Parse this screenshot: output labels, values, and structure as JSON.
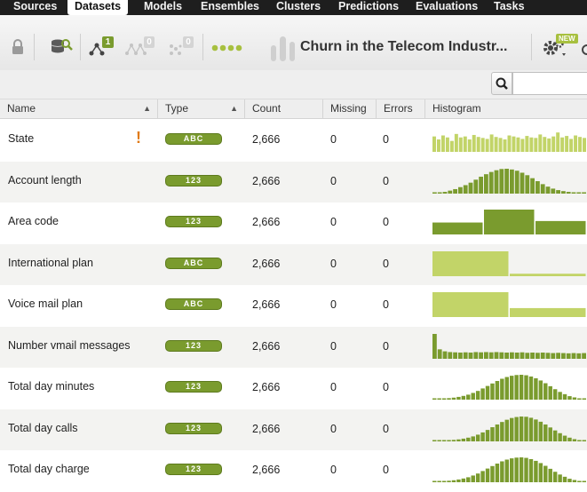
{
  "nav": {
    "tabs": [
      {
        "label": "Sources",
        "active": false
      },
      {
        "label": "Datasets",
        "active": true
      },
      {
        "label": "Models",
        "active": false
      },
      {
        "label": "Ensembles",
        "active": false
      },
      {
        "label": "Clusters",
        "active": false
      },
      {
        "label": "Predictions",
        "active": false
      },
      {
        "label": "Evaluations",
        "active": false
      },
      {
        "label": "Tasks",
        "active": false
      }
    ]
  },
  "toolbar": {
    "dataset_title": "Churn in the Telecom Industr...",
    "model_count_badge": "1",
    "ensemble_count_badge": "0",
    "cluster_count_badge": "0",
    "new_badge": "NEW"
  },
  "search": {
    "value": "",
    "placeholder": ""
  },
  "table": {
    "headers": {
      "name": "Name",
      "type": "Type",
      "count": "Count",
      "missing": "Missing",
      "errors": "Errors",
      "histogram": "Histogram"
    },
    "rows": [
      {
        "name": "State",
        "type": "ABC",
        "count": "2,666",
        "missing": "0",
        "errors": "0",
        "warning": true,
        "histogram": [
          0.62,
          0.5,
          0.66,
          0.58,
          0.44,
          0.72,
          0.58,
          0.62,
          0.5,
          0.68,
          0.6,
          0.56,
          0.52,
          0.7,
          0.6,
          0.56,
          0.5,
          0.66,
          0.62,
          0.58,
          0.52,
          0.64,
          0.58,
          0.56,
          0.7,
          0.6,
          0.54,
          0.62,
          0.78,
          0.58,
          0.64,
          0.52,
          0.66,
          0.6,
          0.56
        ]
      },
      {
        "name": "Account length",
        "type": "123",
        "count": "2,666",
        "missing": "0",
        "errors": "0",
        "warning": false,
        "histogram": [
          0.03,
          0.05,
          0.07,
          0.12,
          0.18,
          0.26,
          0.34,
          0.44,
          0.56,
          0.68,
          0.78,
          0.87,
          0.94,
          0.99,
          1.0,
          0.97,
          0.92,
          0.84,
          0.74,
          0.62,
          0.5,
          0.38,
          0.28,
          0.2,
          0.14,
          0.1,
          0.07,
          0.05,
          0.04,
          0.03
        ]
      },
      {
        "name": "Area code",
        "type": "123",
        "count": "2,666",
        "missing": "0",
        "errors": "0",
        "warning": false,
        "histogram": [
          0.48,
          1.0,
          0.54
        ]
      },
      {
        "name": "International plan",
        "type": "ABC",
        "count": "2,666",
        "missing": "0",
        "errors": "0",
        "warning": false,
        "histogram": [
          1.0,
          0.1
        ]
      },
      {
        "name": "Voice mail plan",
        "type": "ABC",
        "count": "2,666",
        "missing": "0",
        "errors": "0",
        "warning": false,
        "histogram": [
          1.0,
          0.36
        ]
      },
      {
        "name": "Number vmail messages",
        "type": "123",
        "count": "2,666",
        "missing": "0",
        "errors": "0",
        "warning": false,
        "histogram": [
          1.0,
          0.38,
          0.3,
          0.27,
          0.26,
          0.25,
          0.26,
          0.25,
          0.27,
          0.26,
          0.27,
          0.26,
          0.27,
          0.26,
          0.25,
          0.26,
          0.25,
          0.26,
          0.24,
          0.25,
          0.24,
          0.25,
          0.24,
          0.23,
          0.24,
          0.23,
          0.22,
          0.23,
          0.22,
          0.23
        ]
      },
      {
        "name": "Total day minutes",
        "type": "123",
        "count": "2,666",
        "missing": "0",
        "errors": "0",
        "warning": false,
        "histogram": [
          0.02,
          0.03,
          0.04,
          0.06,
          0.08,
          0.11,
          0.15,
          0.2,
          0.27,
          0.35,
          0.45,
          0.55,
          0.65,
          0.75,
          0.84,
          0.91,
          0.96,
          0.99,
          1.0,
          0.98,
          0.93,
          0.86,
          0.77,
          0.66,
          0.54,
          0.42,
          0.31,
          0.22,
          0.14,
          0.09,
          0.05,
          0.03
        ]
      },
      {
        "name": "Total day calls",
        "type": "123",
        "count": "2,666",
        "missing": "0",
        "errors": "0",
        "warning": false,
        "histogram": [
          0.03,
          0.03,
          0.04,
          0.05,
          0.06,
          0.08,
          0.11,
          0.15,
          0.2,
          0.27,
          0.36,
          0.46,
          0.57,
          0.68,
          0.78,
          0.87,
          0.94,
          0.98,
          1.0,
          0.99,
          0.95,
          0.88,
          0.79,
          0.68,
          0.56,
          0.44,
          0.33,
          0.23,
          0.15,
          0.09,
          0.05,
          0.03
        ]
      },
      {
        "name": "Total day charge",
        "type": "123",
        "count": "2,666",
        "missing": "0",
        "errors": "0",
        "warning": false,
        "histogram": [
          0.02,
          0.03,
          0.04,
          0.06,
          0.08,
          0.11,
          0.15,
          0.2,
          0.27,
          0.35,
          0.45,
          0.55,
          0.65,
          0.75,
          0.84,
          0.91,
          0.96,
          0.99,
          1.0,
          0.98,
          0.93,
          0.86,
          0.77,
          0.66,
          0.54,
          0.42,
          0.31,
          0.22,
          0.14,
          0.09,
          0.05,
          0.03
        ]
      }
    ]
  },
  "colors": {
    "hist_dark": "#7a9b2e",
    "hist_light": "#c2d468",
    "badge": "#7a9b2e",
    "warning": "#e07b1a"
  }
}
